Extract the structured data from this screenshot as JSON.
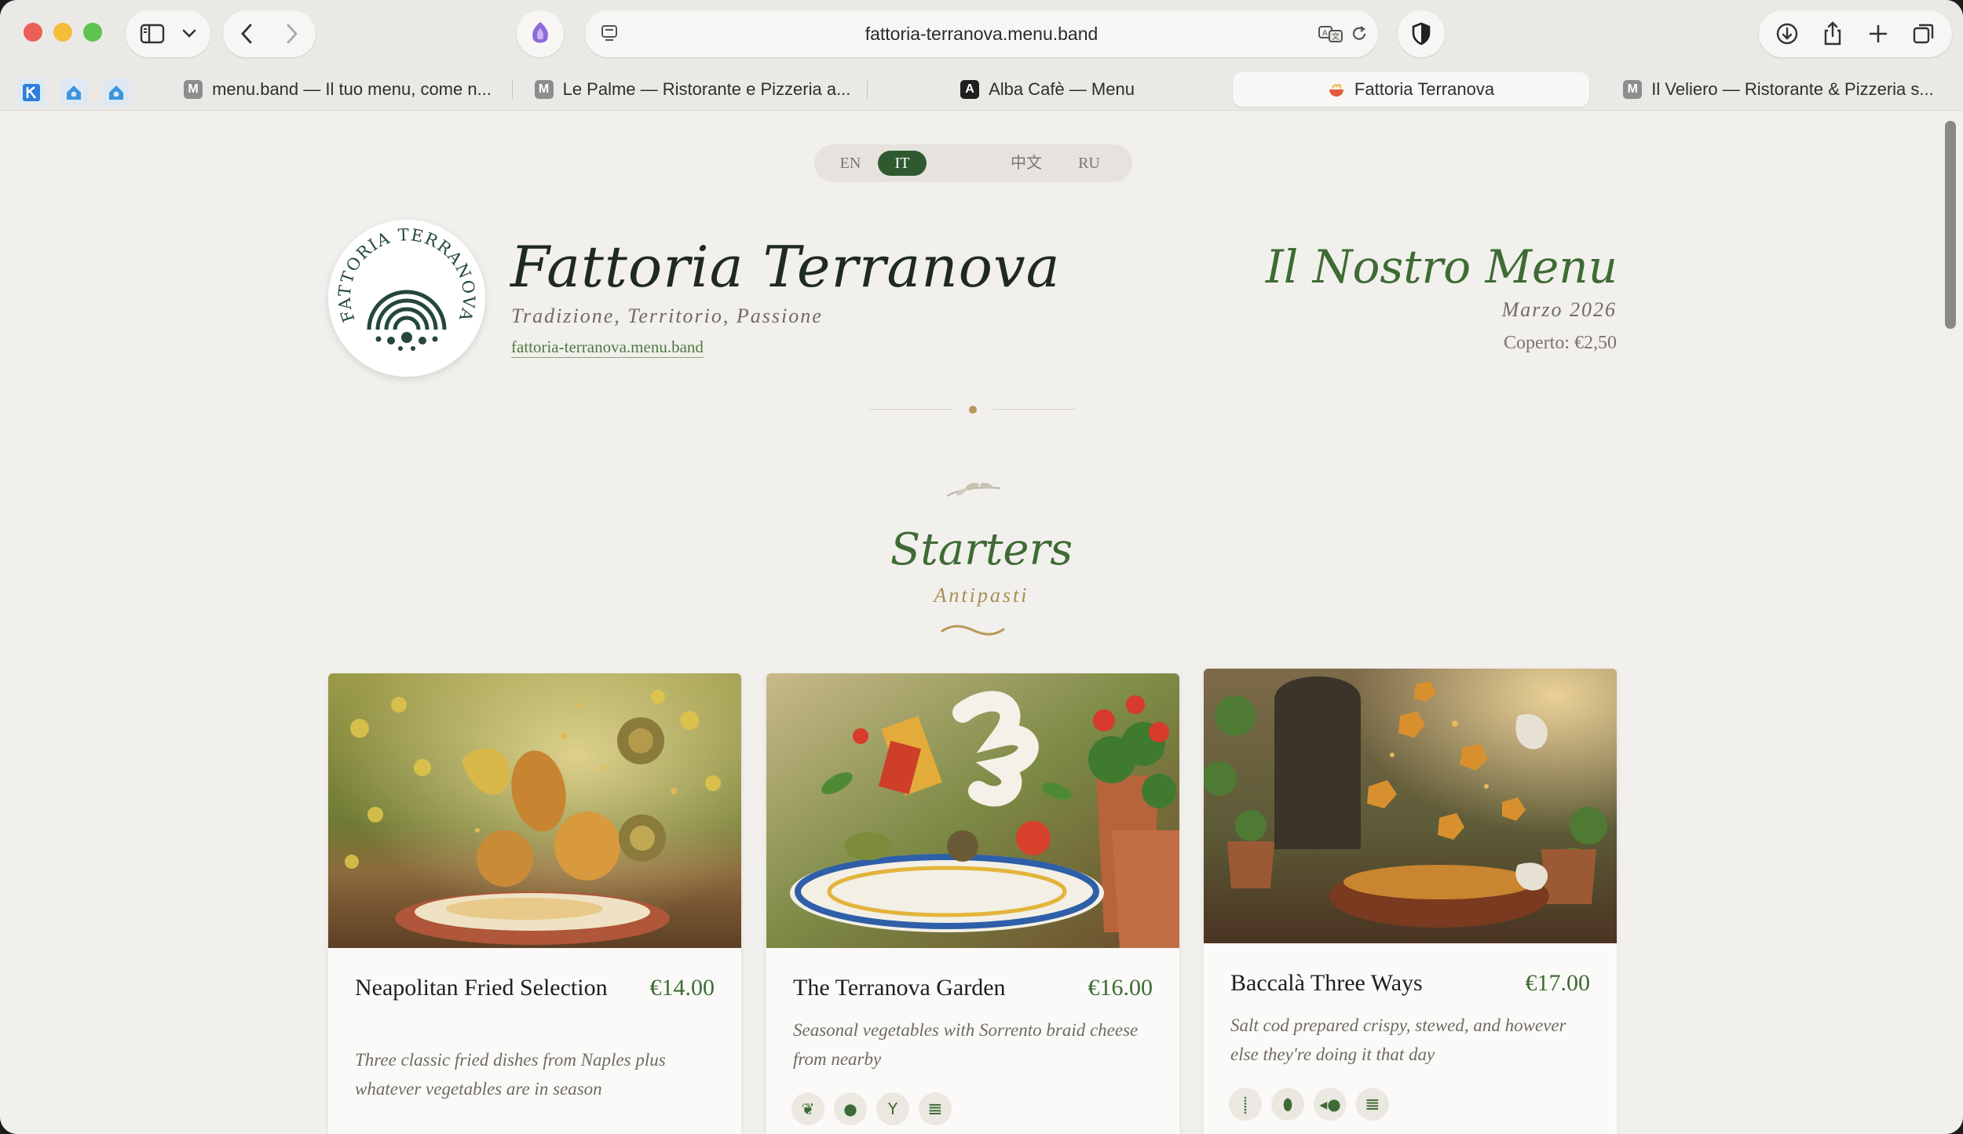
{
  "browser": {
    "address": "fattoria-terranova.menu.band",
    "tabs": [
      {
        "label": "menu.band — Il tuo menu, come n...",
        "icon": "M"
      },
      {
        "label": "Le Palme — Ristorante e Pizzeria a...",
        "icon": "M"
      },
      {
        "label": "Alba Cafè — Menu",
        "icon": "A"
      },
      {
        "label": "Fattoria Terranova",
        "icon": ""
      },
      {
        "label": "Il Veliero — Ristorante & Pizzeria s...",
        "icon": "M"
      }
    ]
  },
  "languages": [
    "EN",
    "IT",
    "中文",
    "RU"
  ],
  "active_language": "IT",
  "restaurant": {
    "name": "Fattoria Terranova",
    "tagline": "Tradizione, Territorio, Passione",
    "url": "fattoria-terranova.menu.band",
    "logo_text": "FATTORIA TERRANOVA"
  },
  "menu_info": {
    "title": "Il Nostro Menu",
    "date": "Marzo 2026",
    "cover": "Coperto: €2,50"
  },
  "section": {
    "title": "Starters",
    "subtitle": "Antipasti"
  },
  "dishes": [
    {
      "name": "Neapolitan Fried Selection",
      "price": "€14.00",
      "description": "Three classic fried dishes from Naples plus whatever vegetables are in season",
      "icons": []
    },
    {
      "name": "The Terranova Garden",
      "price": "€16.00",
      "description": "Seasonal vegetables with Sorrento braid cheese from nearby",
      "icons": [
        "leaf-icon",
        "drop-icon",
        "cocktail-icon",
        "wine-glass-icon"
      ]
    },
    {
      "name": "Baccalà Three Ways",
      "price": "€17.00",
      "description": "Salt cod prepared crispy, stewed, and however else they're doing it that day",
      "icons": [
        "wheat-icon",
        "egg-icon",
        "fish-icon",
        "wine-glass-icon"
      ]
    }
  ],
  "colors": {
    "accent_green": "#3e6b35",
    "gold": "#a98d52",
    "page_bg": "#f2f0ec"
  }
}
